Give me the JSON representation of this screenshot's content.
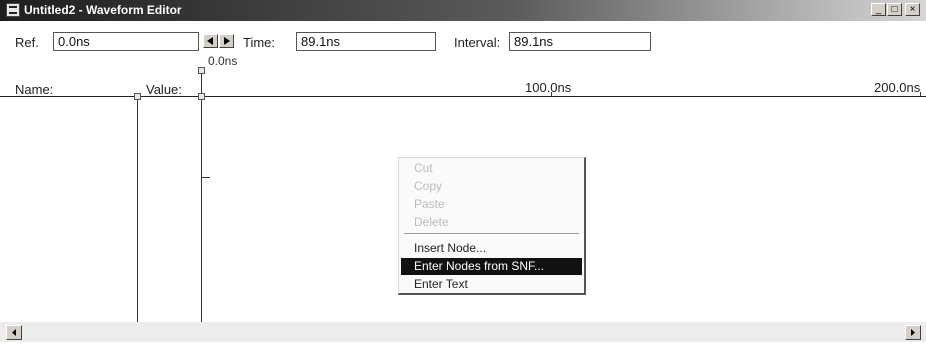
{
  "window": {
    "title": "Untitled2 - Waveform Editor",
    "controls": [
      "minimize-icon",
      "maximize-icon",
      "close-icon"
    ]
  },
  "toolbar": {
    "ref_label": "Ref.",
    "ref_value": "0.0ns",
    "time_label": "Time:",
    "time_value": "89.1ns",
    "interval_label": "Interval:",
    "interval_value": "89.1ns"
  },
  "marker_label": "0.0ns",
  "header": {
    "name_label": "Name:",
    "value_label": "Value:",
    "tick_labels": [
      "100.0ns",
      "200.0ns"
    ]
  },
  "context_menu": {
    "items": [
      {
        "label": "Cut",
        "state": "disabled"
      },
      {
        "label": "Copy",
        "state": "disabled"
      },
      {
        "label": "Paste",
        "state": "disabled"
      },
      {
        "label": "Delete",
        "state": "disabled"
      },
      {
        "label": "Insert Node...",
        "state": "enabled"
      },
      {
        "label": "Enter Nodes from SNF...",
        "state": "selected"
      },
      {
        "label": "Enter Text",
        "state": "enabled"
      }
    ]
  },
  "colors": {
    "title_bar_start": "#1e1e1e",
    "title_bar_end": "#d6d6d6",
    "menu_highlight": "#111111",
    "disabled_text": "#bcbcbc"
  }
}
